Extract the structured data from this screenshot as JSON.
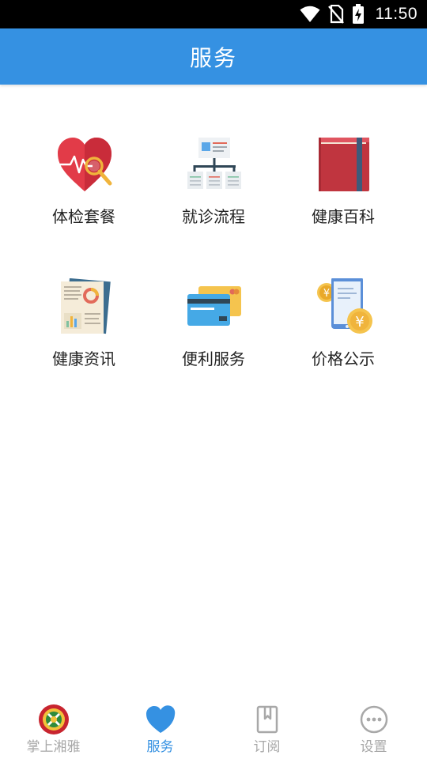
{
  "status_bar": {
    "time": "11:50",
    "icons": [
      "wifi-icon",
      "no-sim-icon",
      "battery-charging-icon"
    ]
  },
  "header": {
    "title": "服务"
  },
  "services": [
    {
      "label": "体检套餐",
      "icon": "heart-checkup-icon"
    },
    {
      "label": "就诊流程",
      "icon": "flowchart-icon"
    },
    {
      "label": "健康百科",
      "icon": "book-icon"
    },
    {
      "label": "健康资讯",
      "icon": "report-document-icon"
    },
    {
      "label": "便利服务",
      "icon": "cards-icon"
    },
    {
      "label": "价格公示",
      "icon": "phone-yuan-icon"
    }
  ],
  "bottom_nav": [
    {
      "label": "掌上湘雅",
      "icon": "xiangya-logo-icon",
      "active": false
    },
    {
      "label": "服务",
      "icon": "heart-icon",
      "active": true
    },
    {
      "label": "订阅",
      "icon": "bookmark-icon",
      "active": false
    },
    {
      "label": "设置",
      "icon": "more-circle-icon",
      "active": false
    }
  ],
  "colors": {
    "primary": "#3591e2",
    "inactive": "#a8a8a8",
    "text": "#222222"
  }
}
